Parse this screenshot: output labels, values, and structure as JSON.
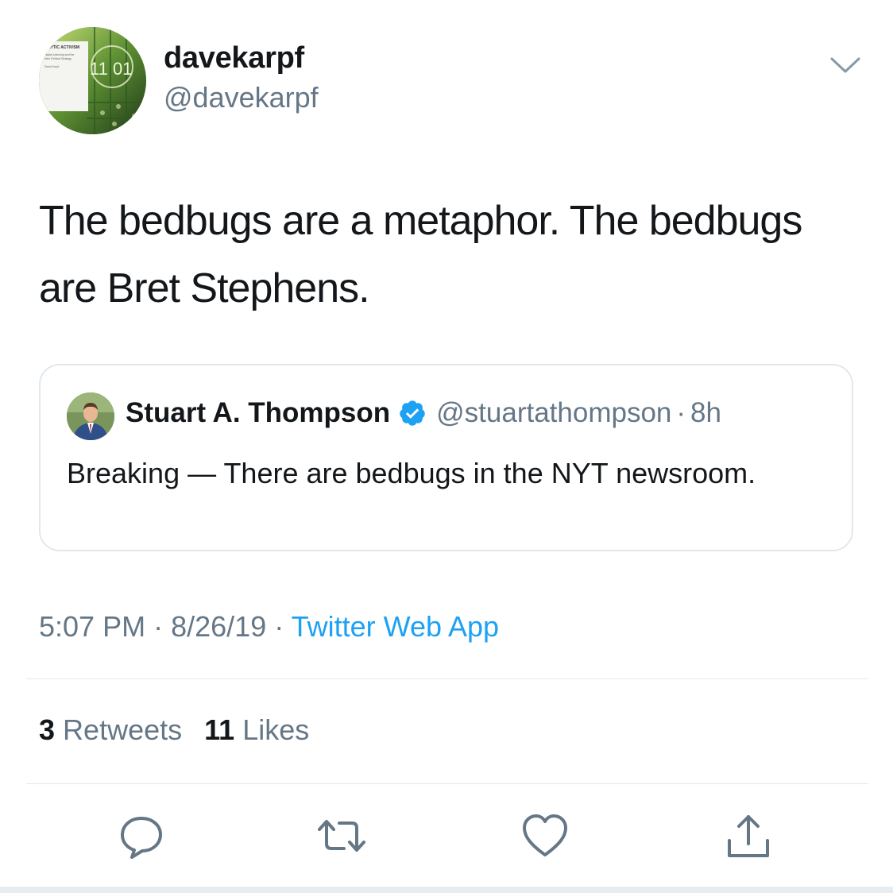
{
  "author": {
    "display_name": "davekarpf",
    "handle": "@davekarpf",
    "avatar_text": {
      "title": ".ALYTIC ACTIVISM",
      "line1": "Digital Listening and the",
      "line2": "New Political Strategy",
      "line3": "David Karpf",
      "digits": "11 01"
    }
  },
  "tweet": {
    "text": "The bedbugs are a metaphor. The bedbugs are Bret Stephens."
  },
  "quoted_tweet": {
    "display_name": "Stuart A. Thompson",
    "handle": "@stuartathompson",
    "separator": "·",
    "time": "8h",
    "text": "Breaking — There are bedbugs in the NYT newsroom."
  },
  "meta": {
    "time": "5:07 PM",
    "separator": "·",
    "date": "8/26/19",
    "source": "Twitter Web App"
  },
  "stats": {
    "retweets_count": "3",
    "retweets_label": "Retweets",
    "likes_count": "11",
    "likes_label": "Likes"
  },
  "icons": {
    "menu": "chevron-down-icon",
    "verified": "verified-badge-icon",
    "reply": "reply-icon",
    "retweet": "retweet-icon",
    "like": "heart-icon",
    "share": "share-icon"
  },
  "colors": {
    "text": "#14171a",
    "secondary": "#657786",
    "accent": "#1da1f2",
    "border": "#e1e8ed"
  }
}
